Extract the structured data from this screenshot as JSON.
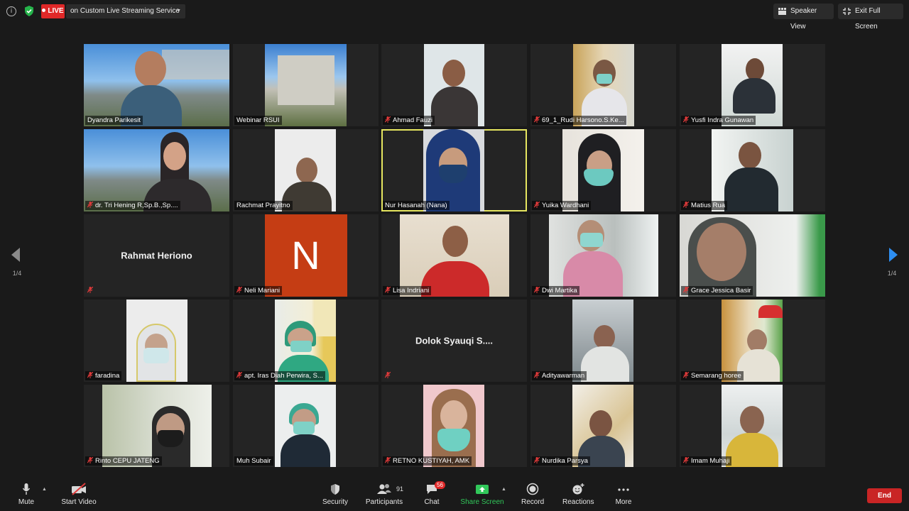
{
  "topbar": {
    "live_label": "LIVE",
    "stream_service": "on Custom Live Streaming Service",
    "speaker_view_label": "Speaker View",
    "exit_fullscreen_label": "Exit Full Screen"
  },
  "colors": {
    "live_red": "#e02828",
    "active_speaker_outline": "#e6e660",
    "share_green": "#31c85a",
    "end_red": "#c92525",
    "nav_arrow_left": "#8a8a8a",
    "nav_arrow_right": "#2e8ef0"
  },
  "pagination": {
    "left": "1/4",
    "right": "1/4"
  },
  "participants": [
    {
      "name": "Dyandra Parikesit",
      "muted": false
    },
    {
      "name": "Webinar RSUI",
      "muted": false
    },
    {
      "name": "Ahmad Fauzi",
      "muted": true
    },
    {
      "name": "69_1_Rudi Harsono.S.Ke...",
      "muted": true
    },
    {
      "name": "Yusfi Indra Gunawan",
      "muted": true
    },
    {
      "name": "dr. Tri Hening R,Sp.B.,Sp....",
      "muted": true
    },
    {
      "name": "Rachmat Prayitno",
      "muted": false
    },
    {
      "name": "Nur Hasanah (Nana)",
      "muted": false,
      "active_speaker": true
    },
    {
      "name": "Yuika Wardhani",
      "muted": true
    },
    {
      "name": "Matius Rua",
      "muted": true
    },
    {
      "name": "Rahmat Heriono",
      "muted": true,
      "video_off": true
    },
    {
      "name": "Neli Mariani",
      "muted": true,
      "avatar_letter": "N"
    },
    {
      "name": "Lisa Indriani",
      "muted": true
    },
    {
      "name": "Dwi Martika",
      "muted": true
    },
    {
      "name": "Grace Jessica Basir",
      "muted": true
    },
    {
      "name": "faradina",
      "muted": true
    },
    {
      "name": "apt. Iras Diah Perwira, S...",
      "muted": true
    },
    {
      "name": "Dolok Syauqi S....",
      "muted": true,
      "video_off": true
    },
    {
      "name": "Adityawarman",
      "muted": true
    },
    {
      "name": "Semarang horee",
      "muted": true
    },
    {
      "name": "Rinto CEPU JATENG",
      "muted": true
    },
    {
      "name": "Muh Subair",
      "muted": false
    },
    {
      "name": "RETNO KUSTIYAH, AMK",
      "muted": true
    },
    {
      "name": "Nurdika Parsya",
      "muted": true
    },
    {
      "name": "Imam Muhaji",
      "muted": true
    }
  ],
  "toolbar": {
    "mute_label": "Mute",
    "start_video_label": "Start Video",
    "security_label": "Security",
    "participants_label": "Participants",
    "participants_count": "91",
    "chat_label": "Chat",
    "chat_badge": "56",
    "share_screen_label": "Share Screen",
    "record_label": "Record",
    "reactions_label": "Reactions",
    "more_label": "More",
    "end_label": "End"
  }
}
